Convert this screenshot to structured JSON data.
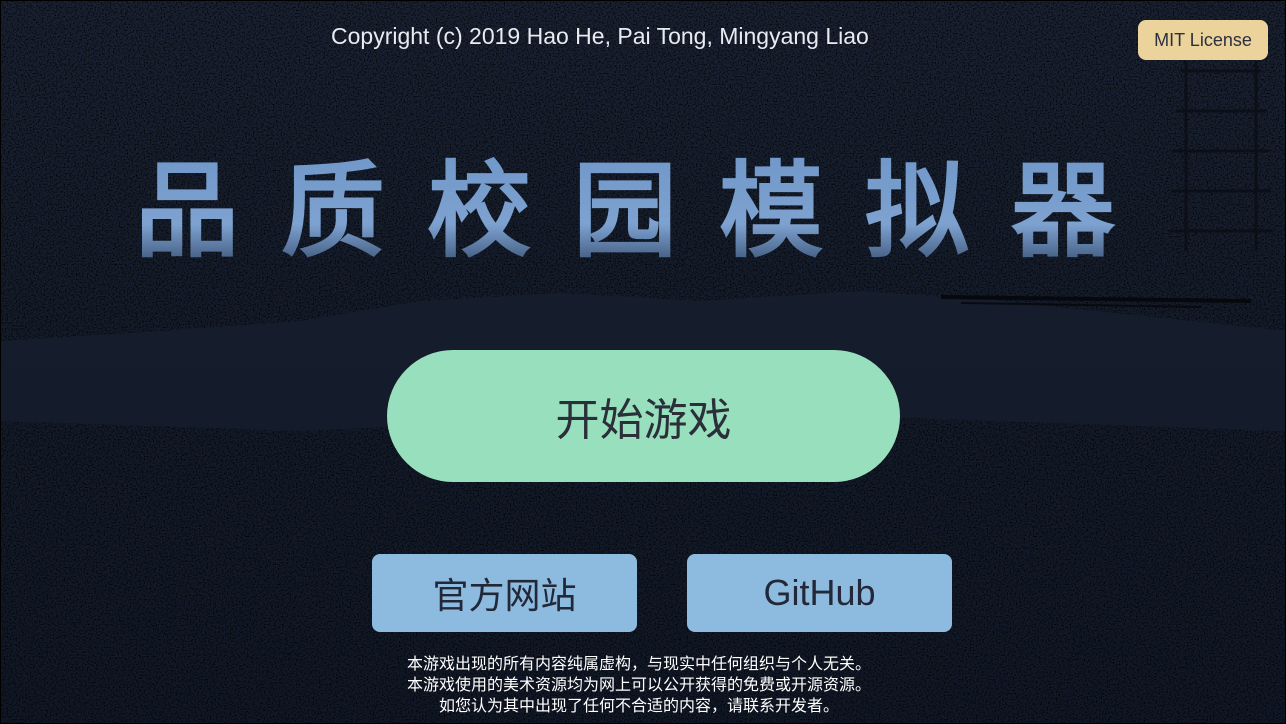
{
  "header": {
    "copyright": "Copyright (c) 2019 Hao He, Pai Tong, Mingyang Liao",
    "license_button": "MIT License"
  },
  "title": "品质校园模拟器",
  "buttons": {
    "start": "开始游戏",
    "website": "官方网站",
    "github": "GitHub"
  },
  "disclaimer": [
    "本游戏出现的所有内容纯属虚构，与现实中任何组织与个人无关。",
    "本游戏使用的美术资源均为网上可以公开获得的免费或开源资源。",
    "如您认为其中出现了任何不合适的内容，请联系开发者。"
  ],
  "colors": {
    "background": "#111827",
    "title": "#6f97c9",
    "start_button": "#98e0bd",
    "link_button": "#8dbbe0",
    "license_button": "#ecd39b"
  }
}
